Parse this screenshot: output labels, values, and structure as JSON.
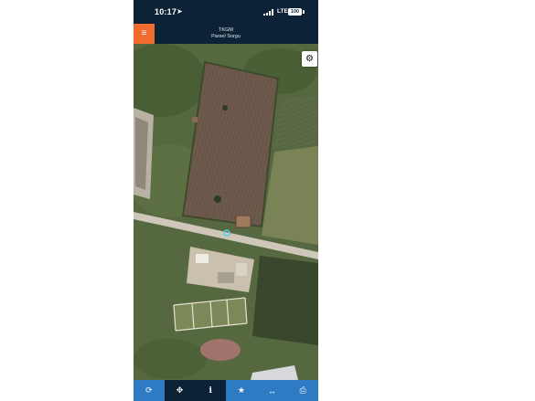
{
  "status_bar": {
    "time": "10:17",
    "network": "LTE",
    "battery": "100",
    "location_icon": "location-arrow-icon"
  },
  "header": {
    "menu_icon": "hamburger-icon",
    "title_line1": "TKGM",
    "title_line2": "Parsel Sorgu"
  },
  "map": {
    "type": "satellite",
    "settings_icon": "gear-icon",
    "marker": "location-marker"
  },
  "bottom_bar": {
    "tabs": [
      {
        "icon": "refresh-icon",
        "glyph": "⟳",
        "style": "blue"
      },
      {
        "icon": "locate-icon",
        "glyph": "✥",
        "style": "dark"
      },
      {
        "icon": "info-icon",
        "glyph": "i",
        "style": "dark"
      },
      {
        "icon": "star-icon",
        "glyph": "★",
        "style": "blue"
      },
      {
        "icon": "measure-icon",
        "glyph": "↔",
        "style": "blue"
      },
      {
        "icon": "print-icon",
        "glyph": "⎙",
        "style": "blue"
      }
    ]
  },
  "colors": {
    "header_bg": "#0c2236",
    "accent_orange": "#f26b2e",
    "tab_blue": "#2e7bc4"
  }
}
